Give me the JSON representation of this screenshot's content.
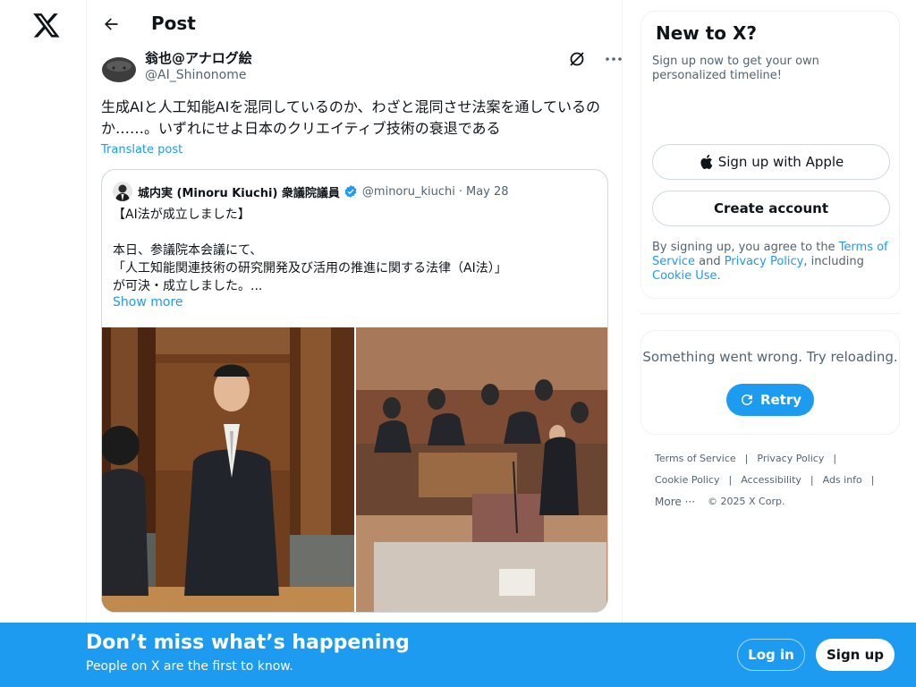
{
  "header": {
    "title": "Post"
  },
  "post": {
    "author_name": "翁也@アナログ絵",
    "author_handle": "@AI_Shinonome",
    "text": "生成AIと人工知能AIを混同しているのか、わざと混同させ法案を通しているのか……。いずれにせよ日本のクリエイティブ技術の衰退である",
    "translate_label": "Translate post"
  },
  "quote": {
    "author_name": "城内実 (Minoru Kiuchi) 衆議院議員",
    "author_handle": "@minoru_kiuchi",
    "separator": "·",
    "date": "May 28",
    "lines": [
      "【AI法が成立しました】",
      "",
      "本日、参議院本会議にて、",
      "「人工知能関連技術の研究開発及び活用の推進に関する法律（AI法）」",
      "が可決・成立しました。..."
    ],
    "show_more": "Show more"
  },
  "signup_card": {
    "title": "New to X?",
    "subtitle": "Sign up now to get your own personalized timeline!",
    "apple_button": "Sign up with Apple",
    "create_button": "Create account",
    "legal_prefix": "By signing up, you agree to the ",
    "terms": "Terms of Service",
    "and": " and ",
    "privacy": "Privacy Policy",
    "including": ", including ",
    "cookie": "Cookie Use",
    "period": "."
  },
  "error_card": {
    "message": "Something went wrong. Try reloading.",
    "retry": "Retry"
  },
  "footer": {
    "terms": "Terms of Service",
    "privacy": "Privacy Policy",
    "cookie": "Cookie Policy",
    "accessibility": "Accessibility",
    "ads": "Ads info",
    "more": "More ···",
    "copyright": "© 2025 X Corp.",
    "sep": "|"
  },
  "bottom_bar": {
    "title": "Don’t miss what’s happening",
    "subtitle": "People on X are the first to know.",
    "login": "Log in",
    "signup": "Sign up"
  },
  "colors": {
    "accent": "#1d9bf0",
    "text": "#0f1419",
    "secondary": "#536471",
    "border": "#eff3f4"
  }
}
